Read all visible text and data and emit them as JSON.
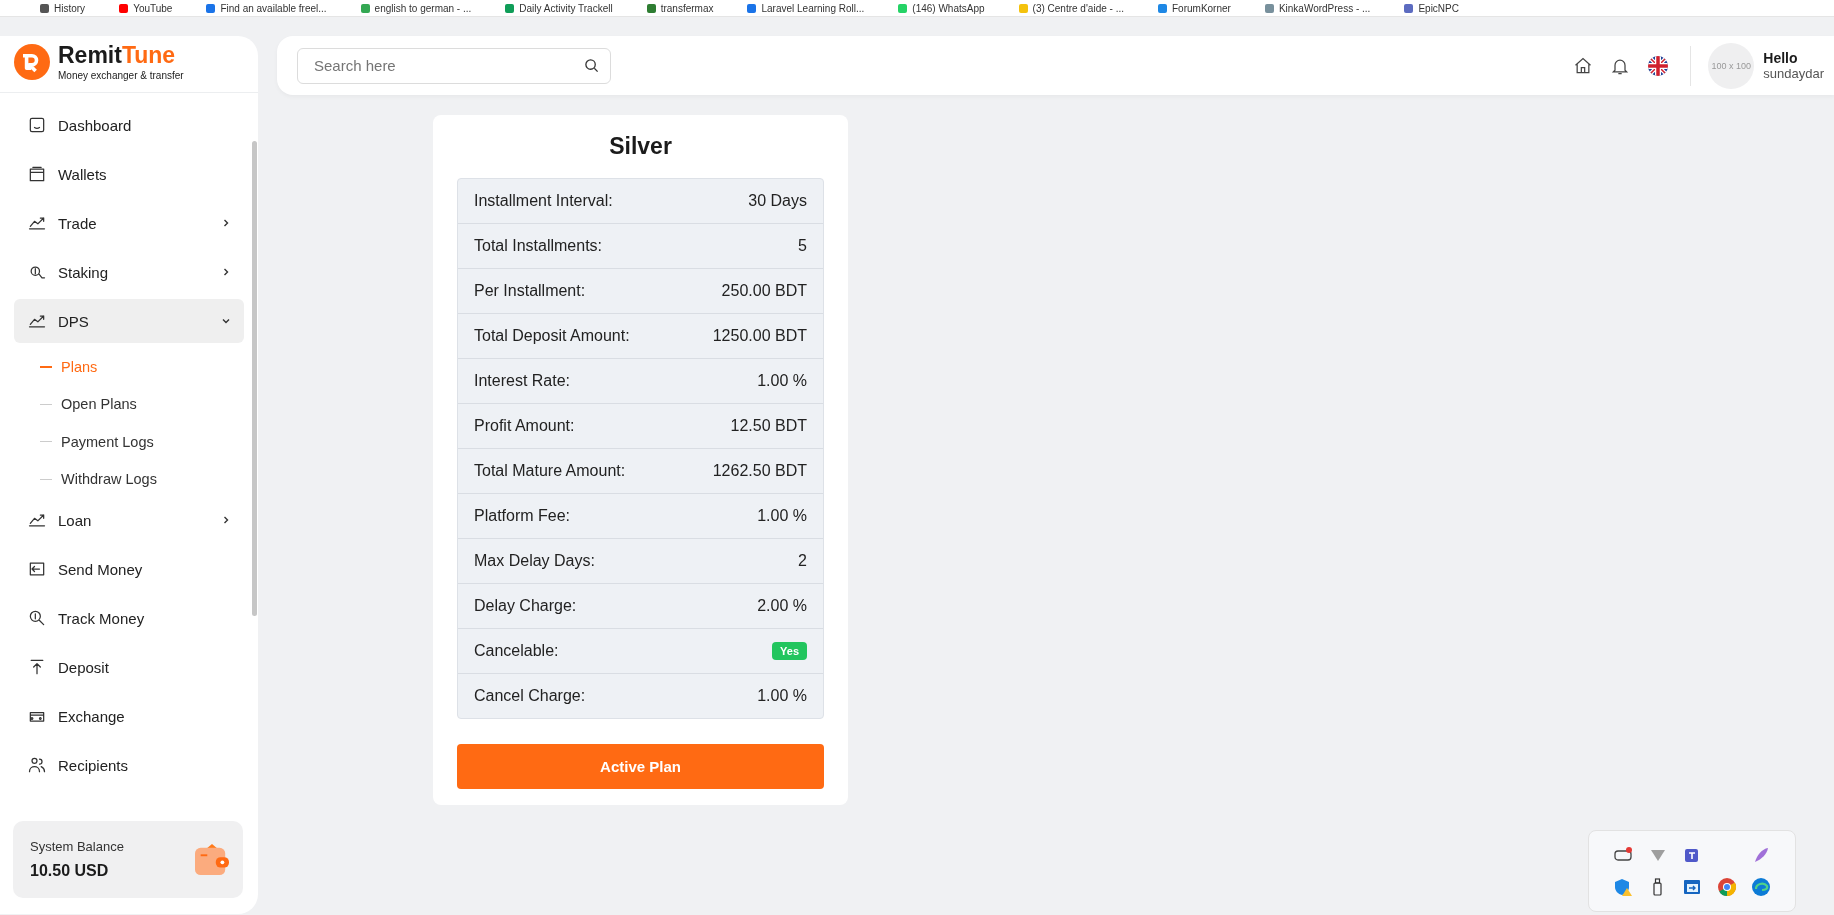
{
  "bookmarks": [
    {
      "label": "History"
    },
    {
      "label": "YouTube"
    },
    {
      "label": "Find an available freel..."
    },
    {
      "label": "english to german - ..."
    },
    {
      "label": "Daily Activity Trackell"
    },
    {
      "label": "transfermax"
    },
    {
      "label": "Laravel Learning Roll..."
    },
    {
      "label": "(146) WhatsApp"
    },
    {
      "label": "(3) Centre d'aide - ..."
    },
    {
      "label": "ForumKorner"
    },
    {
      "label": "KinkaWordPress - ..."
    },
    {
      "label": "EpicNPC"
    }
  ],
  "brand": {
    "name_first": "Remit",
    "name_second": "Tune",
    "tagline": "Money exchanger & transfer"
  },
  "sidebar": {
    "items": [
      {
        "label": "Dashboard",
        "kind": "link",
        "selected": false
      },
      {
        "label": "Wallets",
        "kind": "link",
        "selected": false
      },
      {
        "label": "Trade",
        "kind": "group",
        "expanded": false,
        "selected": false
      },
      {
        "label": "Staking",
        "kind": "group",
        "expanded": false,
        "selected": false
      },
      {
        "label": "DPS",
        "kind": "group",
        "expanded": true,
        "selected": true,
        "children": [
          {
            "label": "Plans",
            "selected": true
          },
          {
            "label": "Open Plans",
            "selected": false
          },
          {
            "label": "Payment Logs",
            "selected": false
          },
          {
            "label": "Withdraw Logs",
            "selected": false
          }
        ]
      },
      {
        "label": "Loan",
        "kind": "group",
        "expanded": false,
        "selected": false
      },
      {
        "label": "Send Money",
        "kind": "link",
        "selected": false
      },
      {
        "label": "Track Money",
        "kind": "link",
        "selected": false
      },
      {
        "label": "Deposit",
        "kind": "link",
        "selected": false
      },
      {
        "label": "Exchange",
        "kind": "link",
        "selected": false
      },
      {
        "label": "Recipients",
        "kind": "link",
        "selected": false
      }
    ],
    "balance": {
      "label": "System Balance",
      "amount": "10.50 USD"
    }
  },
  "header": {
    "search": {
      "placeholder": "Search here"
    },
    "avatar_text": "100 x 100",
    "greeting": "Hello",
    "username": "sundaydar"
  },
  "plan": {
    "title": "Silver",
    "rows": [
      {
        "label": "Installment Interval:",
        "value": "30 Days",
        "kind": "text"
      },
      {
        "label": "Total Installments:",
        "value": "5",
        "kind": "text"
      },
      {
        "label": "Per Installment:",
        "value": "250.00 BDT",
        "kind": "text"
      },
      {
        "label": "Total Deposit Amount:",
        "value": "1250.00 BDT",
        "kind": "text"
      },
      {
        "label": "Interest Rate:",
        "value": "1.00 %",
        "kind": "text"
      },
      {
        "label": "Profit Amount:",
        "value": "12.50 BDT",
        "kind": "text"
      },
      {
        "label": "Total Mature Amount:",
        "value": "1262.50 BDT",
        "kind": "text"
      },
      {
        "label": "Platform Fee:",
        "value": "1.00 %",
        "kind": "text"
      },
      {
        "label": "Max Delay Days:",
        "value": "2",
        "kind": "text"
      },
      {
        "label": "Delay Charge:",
        "value": "2.00 %",
        "kind": "text"
      },
      {
        "label": "Cancelable:",
        "value": "Yes",
        "kind": "badge"
      },
      {
        "label": "Cancel Charge:",
        "value": "1.00 %",
        "kind": "text"
      }
    ],
    "button": "Active Plan"
  }
}
